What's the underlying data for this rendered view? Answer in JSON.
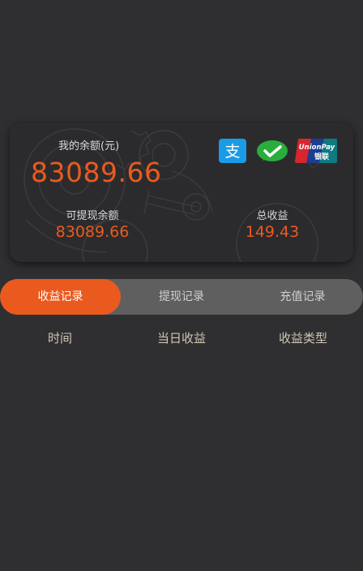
{
  "balance_card": {
    "balance_label": "我的余额(元)",
    "balance_amount": "83089.66",
    "available_label": "可提现余额",
    "available_amount": "83089.66",
    "total_income_label": "总收益",
    "total_income_amount": "149.43",
    "payment_methods": [
      {
        "name": "alipay-icon",
        "glyph": "支",
        "color": "#1b9be6"
      },
      {
        "name": "wechat-pay-icon",
        "color": "#2aae3b"
      },
      {
        "name": "unionpay-icon",
        "text_en": "UnionPay",
        "text_cn": "银联",
        "colors": [
          "#d8262d",
          "#1d3d8f",
          "#0f7a80"
        ]
      }
    ],
    "accent_color": "#ea5a1f"
  },
  "tabs": {
    "active_index": 0,
    "items": [
      {
        "label": "收益记录"
      },
      {
        "label": "提现记录"
      },
      {
        "label": "充值记录"
      }
    ]
  },
  "table": {
    "columns": [
      "时间",
      "当日收益",
      "收益类型"
    ]
  }
}
